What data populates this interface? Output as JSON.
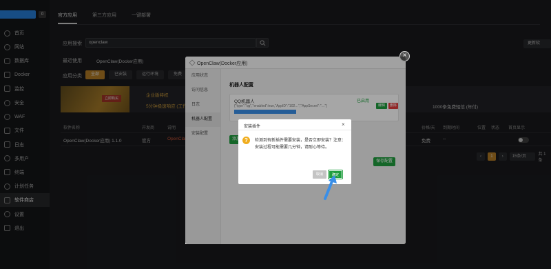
{
  "sidebar": {
    "badge": "0",
    "items": [
      {
        "label": "首页",
        "icon": "home-icon"
      },
      {
        "label": "网站",
        "icon": "globe-icon"
      },
      {
        "label": "数据库",
        "icon": "database-icon"
      },
      {
        "label": "Docker",
        "icon": "docker-icon"
      },
      {
        "label": "监控",
        "icon": "monitor-icon"
      },
      {
        "label": "安全",
        "icon": "shield-icon"
      },
      {
        "label": "WAF",
        "icon": "waf-icon"
      },
      {
        "label": "文件",
        "icon": "folder-icon"
      },
      {
        "label": "日志",
        "icon": "log-icon"
      },
      {
        "label": "多用户",
        "icon": "users-icon"
      },
      {
        "label": "终端",
        "icon": "terminal-icon"
      },
      {
        "label": "计划任务",
        "icon": "clock-icon"
      },
      {
        "label": "软件商店",
        "icon": "store-icon"
      },
      {
        "label": "设置",
        "icon": "gear-icon"
      },
      {
        "label": "退出",
        "icon": "logout-icon"
      }
    ]
  },
  "tabs": [
    "官方应用",
    "第三方应用",
    "一键部署"
  ],
  "search": {
    "label": "应用搜索",
    "value": "openclaw"
  },
  "recent": {
    "label": "最近使用",
    "item": "OpenClaw(Docker应用)"
  },
  "categories": {
    "label": "应用分类",
    "items": [
      "全部",
      "已安装",
      "运行环境",
      "免费"
    ]
  },
  "top_right_button": "更新软",
  "banner": {
    "tag": "立即购买",
    "text1": "企业版特权",
    "text2": "5分钟极速响应 (工作",
    "text3": "1000条免费短信 (年付)"
  },
  "table": {
    "headers": [
      "软件名称",
      "开发商",
      "说明",
      "价格/天",
      "到期时间",
      "位置",
      "状态",
      "首页显示"
    ],
    "row": {
      "name": "OpenClaw(Docker应用) 1.1.0",
      "dev": "官方",
      "desc": "OpenClaw",
      "price": "免费",
      "expire": "--"
    }
  },
  "pager": {
    "current": "1",
    "per_page": "15条/页",
    "total": "共 1 条"
  },
  "dialog": {
    "title": "OpenClaw(Docker应用)",
    "side": [
      "应用状态",
      "访问信息",
      "日志",
      "机器人配置",
      "安装配置"
    ],
    "active_side": 3,
    "section_title": "机器人配置",
    "robot": {
      "name": "QQ机器人",
      "status": "已启用",
      "json": "{\"type\":\"qq\",\"enabled\":true,\"AppID\":\"102…\",\"AppSecret\":\"…\"}",
      "edit": "编辑",
      "delete": "删除"
    },
    "add_button": "添加",
    "save_button": "保存配置"
  },
  "confirm": {
    "title": "安装插件",
    "message": "检测到有新插件需要安装，是否立即安装？注意：安装过程可能需要几分钟，请耐心等待。",
    "cancel": "取消",
    "ok": "确定"
  },
  "colors": {
    "accent": "#c98a2b",
    "green": "#1f9d3e",
    "blue_arrow": "#3a8fe8"
  }
}
